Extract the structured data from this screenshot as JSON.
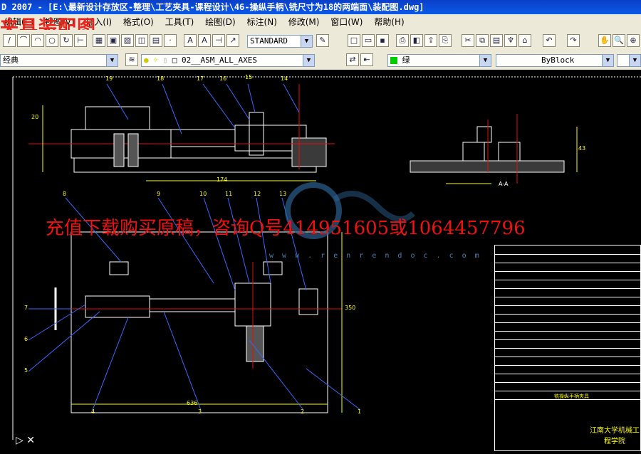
{
  "title_bar": {
    "text": "D 2007 - [E:\\最新设计存放区-整理\\工艺夹具-课程设计\\46-操纵手柄\\铣尺寸为18的两端面\\装配图.dwg]"
  },
  "watermark_overlay": "夹具装配图",
  "menu": [
    {
      "label": "编辑(E)"
    },
    {
      "label": "视图(V)"
    },
    {
      "label": "插入(I)"
    },
    {
      "label": "格式(O)"
    },
    {
      "label": "工具(T)"
    },
    {
      "label": "绘图(D)"
    },
    {
      "label": "标注(N)"
    },
    {
      "label": "修改(M)"
    },
    {
      "label": "窗口(W)"
    },
    {
      "label": "帮助(H)"
    }
  ],
  "toolbar": {
    "text_style": "STANDARD",
    "layer": "02__ASM_ALL_AXES",
    "workspace": "经典",
    "color": "绿",
    "linetype": "ByBlock"
  },
  "overlay": {
    "promo": "充值下载购买原稿，咨询Q号414951605或1064457796",
    "site": "w w w . r e n r e n d o c . c o m"
  },
  "drawing": {
    "section_label": "A-A",
    "callouts": [
      "19",
      "18",
      "17",
      "16",
      "15",
      "14",
      "8",
      "9",
      "10",
      "11",
      "12",
      "13",
      "7",
      "6",
      "5",
      "4",
      "3",
      "2",
      "1"
    ],
    "dims": {
      "d20": "20",
      "d174": "174",
      "d636": "636",
      "d350": "350",
      "d43": "43"
    },
    "title_block": {
      "part_name": "铣操纵手柄夹具",
      "school": "江南大学机械工程学院"
    }
  },
  "colors": {
    "title_bg": "#0a3fc8",
    "canvas_bg": "#000000",
    "ui_bg": "#ece9d8",
    "promo": "#f01010",
    "watermark": "#e8261c"
  }
}
